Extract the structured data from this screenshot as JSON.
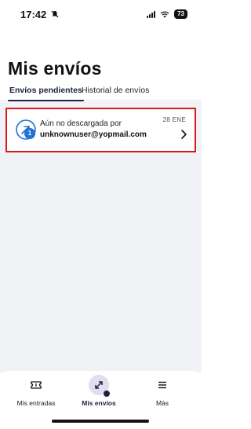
{
  "status_bar": {
    "time": "17:42",
    "battery": "73"
  },
  "page": {
    "title": "Mis envíos"
  },
  "tabs": [
    {
      "label": "Envíos pendientes",
      "active": true
    },
    {
      "label": "Historial de envíos",
      "active": false
    }
  ],
  "transfer_card": {
    "status": "Aún no descargada por",
    "recipient": "unknownuser@yopmail.com",
    "date": "28 ENE",
    "badge_count": "1"
  },
  "bottom_nav": [
    {
      "label": "Mis entradas",
      "icon": "ticket-icon",
      "active": false
    },
    {
      "label": "Mis envíos",
      "icon": "transfer-arrows-icon",
      "active": true
    },
    {
      "label": "Más",
      "icon": "menu-icon",
      "active": false
    }
  ],
  "colors": {
    "accent": "#1b2240",
    "badge": "#1f72d6",
    "highlight_border": "#d7191d",
    "content_bg": "#f1f2f5",
    "active_nav_bg": "#e4dcef"
  }
}
